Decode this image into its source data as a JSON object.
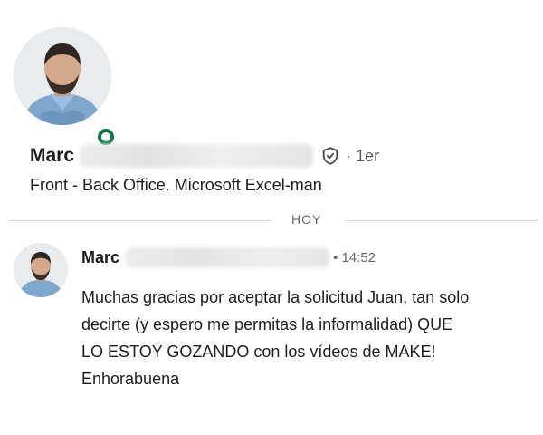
{
  "profile": {
    "name": "Marc",
    "connection_separator": "·",
    "connection_degree": "1er",
    "headline": "Front - Back Office. Microsoft Excel-man",
    "presence": "online",
    "presence_color": "#0b7a43"
  },
  "divider": {
    "label": "HOY"
  },
  "message": {
    "sender": "Marc",
    "time_separator": "•",
    "time": "14:52",
    "body_lines": [
      "Muchas gracias por aceptar la solicitud Juan, tan solo",
      "decirte (y espero me permitas la informalidad) QUE",
      "LO ESTOY GOZANDO con los vídeos de MAKE!",
      "Enhorabuena"
    ]
  },
  "icons": {
    "verified": "shield-check-icon",
    "presence": "online-status-icon"
  }
}
